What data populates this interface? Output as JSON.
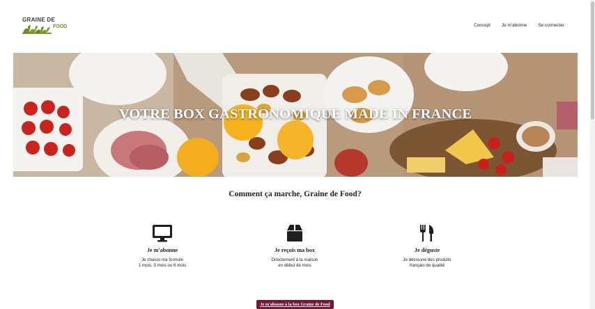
{
  "logo": {
    "line1": "GRAINE DE",
    "line2": "FOOD"
  },
  "nav": {
    "items": [
      "Concept",
      "Je m'abonne",
      "Se connecter"
    ]
  },
  "hero": {
    "title": "VOTRE BOX GASTRONOMIQUE MADE IN FRANCE"
  },
  "how": {
    "title": "Comment ça marche, Graine de Food?",
    "steps": [
      {
        "icon": "monitor-icon",
        "title": "Je m'abonne",
        "desc": [
          "Je choisis ma formule",
          "1 mois, 3 mois ou 6 mois"
        ]
      },
      {
        "icon": "box-icon",
        "title": "Je reçois ma box",
        "desc": [
          "Directement à la maison",
          "en début de mois"
        ]
      },
      {
        "icon": "fork-knife-icon",
        "title": "Je déguste",
        "desc": [
          "Je découvre des produits",
          "français de qualité"
        ]
      }
    ]
  },
  "cta": {
    "label": "Je m'abonne à la box Graine de Food"
  },
  "colors": {
    "accent": "#7a1738",
    "logo_green": "#6a8f1f"
  }
}
